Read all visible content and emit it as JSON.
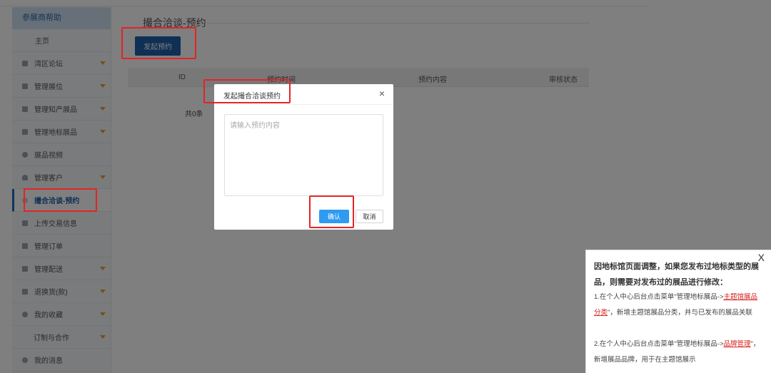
{
  "sidebar": {
    "header": "参展商帮助",
    "items": [
      {
        "label": "主页",
        "icon": "none",
        "caret": false
      },
      {
        "label": "湾区论坛",
        "icon": "forum-icon",
        "caret": true
      },
      {
        "label": "管理展位",
        "icon": "booth-icon",
        "caret": true
      },
      {
        "label": "管理知产展品",
        "icon": "grid-icon",
        "caret": true
      },
      {
        "label": "管理地标展品",
        "icon": "grid-icon",
        "caret": true
      },
      {
        "label": "展品视频",
        "icon": "video-icon",
        "caret": false
      },
      {
        "label": "管理客户",
        "icon": "user-icon",
        "caret": true
      },
      {
        "label": "撮合洽谈-预约",
        "icon": "handshake-icon",
        "caret": false,
        "active": true
      },
      {
        "label": "上传交易信息",
        "icon": "document-icon",
        "caret": false
      },
      {
        "label": "管理订单",
        "icon": "order-icon",
        "caret": false
      },
      {
        "label": "管理配送",
        "icon": "delivery-icon",
        "caret": true
      },
      {
        "label": "退换货(款)",
        "icon": "return-icon",
        "caret": true
      },
      {
        "label": "我的收藏",
        "icon": "star-icon",
        "caret": true
      },
      {
        "label": "订制与合作",
        "icon": "none",
        "caret": true
      },
      {
        "label": "我的消息",
        "icon": "message-icon",
        "caret": false
      }
    ]
  },
  "main": {
    "title": "撮合洽谈-预约",
    "start_button": "发起预约",
    "table": {
      "headers": [
        "ID",
        "预约时间",
        "预约内容",
        "审核状态"
      ]
    },
    "total_text": "共0条"
  },
  "modal": {
    "title": "发起撮合洽谈预约",
    "close_symbol": "×",
    "textarea_placeholder": "请输入预约内容",
    "textarea_value": "",
    "confirm_label": "确认",
    "cancel_label": "取消"
  },
  "notice": {
    "close_symbol": "X",
    "heading": "因地标馆页面调整，如果您发布过地标类型的展品，则需要对发布过的展品进行修改：",
    "item1_before": "1.在个人中心后台点击菜单\"管理地标展品->",
    "item1_link": "主题馆展品分类",
    "item1_after": "\"，新增主题馆展品分类，并与已发布的展品关联",
    "item2_before": "2.在个人中心后台点击菜单\"管理地标展品->",
    "item2_link": "品牌管理",
    "item2_after": "\"，新增展品品牌，用于在主题馆展示"
  },
  "colors": {
    "accent": "#1f5fa8",
    "confirm": "#2e9bf0",
    "highlight": "#e32424",
    "caret": "#e9a12a",
    "link": "#d8231f"
  }
}
